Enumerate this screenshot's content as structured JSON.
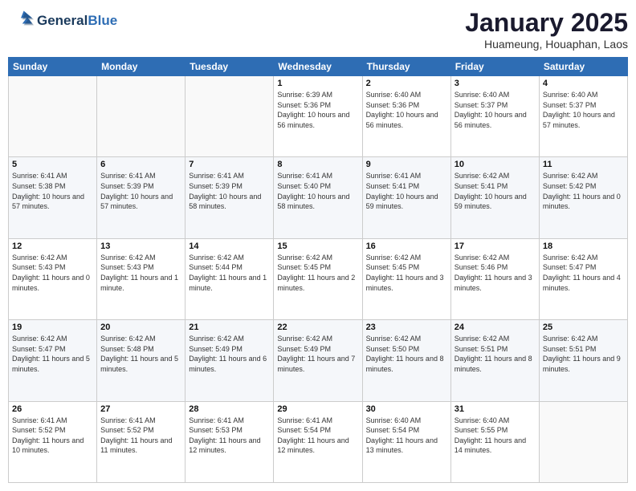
{
  "logo": {
    "line1": "General",
    "line2": "Blue"
  },
  "header": {
    "month": "January 2025",
    "location": "Huameung, Houaphan, Laos"
  },
  "weekdays": [
    "Sunday",
    "Monday",
    "Tuesday",
    "Wednesday",
    "Thursday",
    "Friday",
    "Saturday"
  ],
  "weeks": [
    [
      {
        "day": "",
        "sunrise": "",
        "sunset": "",
        "daylight": ""
      },
      {
        "day": "",
        "sunrise": "",
        "sunset": "",
        "daylight": ""
      },
      {
        "day": "",
        "sunrise": "",
        "sunset": "",
        "daylight": ""
      },
      {
        "day": "1",
        "sunrise": "Sunrise: 6:39 AM",
        "sunset": "Sunset: 5:36 PM",
        "daylight": "Daylight: 10 hours and 56 minutes."
      },
      {
        "day": "2",
        "sunrise": "Sunrise: 6:40 AM",
        "sunset": "Sunset: 5:36 PM",
        "daylight": "Daylight: 10 hours and 56 minutes."
      },
      {
        "day": "3",
        "sunrise": "Sunrise: 6:40 AM",
        "sunset": "Sunset: 5:37 PM",
        "daylight": "Daylight: 10 hours and 56 minutes."
      },
      {
        "day": "4",
        "sunrise": "Sunrise: 6:40 AM",
        "sunset": "Sunset: 5:37 PM",
        "daylight": "Daylight: 10 hours and 57 minutes."
      }
    ],
    [
      {
        "day": "5",
        "sunrise": "Sunrise: 6:41 AM",
        "sunset": "Sunset: 5:38 PM",
        "daylight": "Daylight: 10 hours and 57 minutes."
      },
      {
        "day": "6",
        "sunrise": "Sunrise: 6:41 AM",
        "sunset": "Sunset: 5:39 PM",
        "daylight": "Daylight: 10 hours and 57 minutes."
      },
      {
        "day": "7",
        "sunrise": "Sunrise: 6:41 AM",
        "sunset": "Sunset: 5:39 PM",
        "daylight": "Daylight: 10 hours and 58 minutes."
      },
      {
        "day": "8",
        "sunrise": "Sunrise: 6:41 AM",
        "sunset": "Sunset: 5:40 PM",
        "daylight": "Daylight: 10 hours and 58 minutes."
      },
      {
        "day": "9",
        "sunrise": "Sunrise: 6:41 AM",
        "sunset": "Sunset: 5:41 PM",
        "daylight": "Daylight: 10 hours and 59 minutes."
      },
      {
        "day": "10",
        "sunrise": "Sunrise: 6:42 AM",
        "sunset": "Sunset: 5:41 PM",
        "daylight": "Daylight: 10 hours and 59 minutes."
      },
      {
        "day": "11",
        "sunrise": "Sunrise: 6:42 AM",
        "sunset": "Sunset: 5:42 PM",
        "daylight": "Daylight: 11 hours and 0 minutes."
      }
    ],
    [
      {
        "day": "12",
        "sunrise": "Sunrise: 6:42 AM",
        "sunset": "Sunset: 5:43 PM",
        "daylight": "Daylight: 11 hours and 0 minutes."
      },
      {
        "day": "13",
        "sunrise": "Sunrise: 6:42 AM",
        "sunset": "Sunset: 5:43 PM",
        "daylight": "Daylight: 11 hours and 1 minute."
      },
      {
        "day": "14",
        "sunrise": "Sunrise: 6:42 AM",
        "sunset": "Sunset: 5:44 PM",
        "daylight": "Daylight: 11 hours and 1 minute."
      },
      {
        "day": "15",
        "sunrise": "Sunrise: 6:42 AM",
        "sunset": "Sunset: 5:45 PM",
        "daylight": "Daylight: 11 hours and 2 minutes."
      },
      {
        "day": "16",
        "sunrise": "Sunrise: 6:42 AM",
        "sunset": "Sunset: 5:45 PM",
        "daylight": "Daylight: 11 hours and 3 minutes."
      },
      {
        "day": "17",
        "sunrise": "Sunrise: 6:42 AM",
        "sunset": "Sunset: 5:46 PM",
        "daylight": "Daylight: 11 hours and 3 minutes."
      },
      {
        "day": "18",
        "sunrise": "Sunrise: 6:42 AM",
        "sunset": "Sunset: 5:47 PM",
        "daylight": "Daylight: 11 hours and 4 minutes."
      }
    ],
    [
      {
        "day": "19",
        "sunrise": "Sunrise: 6:42 AM",
        "sunset": "Sunset: 5:47 PM",
        "daylight": "Daylight: 11 hours and 5 minutes."
      },
      {
        "day": "20",
        "sunrise": "Sunrise: 6:42 AM",
        "sunset": "Sunset: 5:48 PM",
        "daylight": "Daylight: 11 hours and 5 minutes."
      },
      {
        "day": "21",
        "sunrise": "Sunrise: 6:42 AM",
        "sunset": "Sunset: 5:49 PM",
        "daylight": "Daylight: 11 hours and 6 minutes."
      },
      {
        "day": "22",
        "sunrise": "Sunrise: 6:42 AM",
        "sunset": "Sunset: 5:49 PM",
        "daylight": "Daylight: 11 hours and 7 minutes."
      },
      {
        "day": "23",
        "sunrise": "Sunrise: 6:42 AM",
        "sunset": "Sunset: 5:50 PM",
        "daylight": "Daylight: 11 hours and 8 minutes."
      },
      {
        "day": "24",
        "sunrise": "Sunrise: 6:42 AM",
        "sunset": "Sunset: 5:51 PM",
        "daylight": "Daylight: 11 hours and 8 minutes."
      },
      {
        "day": "25",
        "sunrise": "Sunrise: 6:42 AM",
        "sunset": "Sunset: 5:51 PM",
        "daylight": "Daylight: 11 hours and 9 minutes."
      }
    ],
    [
      {
        "day": "26",
        "sunrise": "Sunrise: 6:41 AM",
        "sunset": "Sunset: 5:52 PM",
        "daylight": "Daylight: 11 hours and 10 minutes."
      },
      {
        "day": "27",
        "sunrise": "Sunrise: 6:41 AM",
        "sunset": "Sunset: 5:52 PM",
        "daylight": "Daylight: 11 hours and 11 minutes."
      },
      {
        "day": "28",
        "sunrise": "Sunrise: 6:41 AM",
        "sunset": "Sunset: 5:53 PM",
        "daylight": "Daylight: 11 hours and 12 minutes."
      },
      {
        "day": "29",
        "sunrise": "Sunrise: 6:41 AM",
        "sunset": "Sunset: 5:54 PM",
        "daylight": "Daylight: 11 hours and 12 minutes."
      },
      {
        "day": "30",
        "sunrise": "Sunrise: 6:40 AM",
        "sunset": "Sunset: 5:54 PM",
        "daylight": "Daylight: 11 hours and 13 minutes."
      },
      {
        "day": "31",
        "sunrise": "Sunrise: 6:40 AM",
        "sunset": "Sunset: 5:55 PM",
        "daylight": "Daylight: 11 hours and 14 minutes."
      },
      {
        "day": "",
        "sunrise": "",
        "sunset": "",
        "daylight": ""
      }
    ]
  ]
}
